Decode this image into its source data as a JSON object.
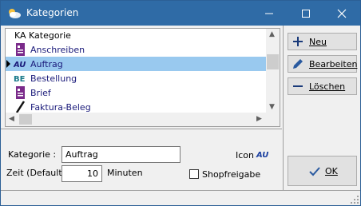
{
  "window": {
    "title": "Kategorien"
  },
  "list": {
    "headers": {
      "ka": "KA",
      "kategorie": "Kategorie"
    },
    "rows": [
      {
        "label": "Anschreiben",
        "icon": "purple-document-icon",
        "selected": false
      },
      {
        "label": "Auftrag",
        "icon": "au-text-icon",
        "selected": true
      },
      {
        "label": "Bestellung",
        "icon": "be-text-icon",
        "selected": false
      },
      {
        "label": "Brief",
        "icon": "purple-document-icon",
        "selected": false
      },
      {
        "label": "Faktura-Beleg",
        "icon": "pen-icon",
        "selected": false
      }
    ]
  },
  "form": {
    "kategorie_label": "Kategorie :",
    "kategorie_value": "Auftrag",
    "zeit_label": "Zeit (Default):",
    "zeit_value": "10",
    "minuten_label": "Minuten",
    "icon_label": "Icon",
    "icon_preview": "AU",
    "shop_label": "Shopfreigabe",
    "shop_checked": false
  },
  "buttons": {
    "neu": "Neu",
    "bearbeiten": "Bearbeiten",
    "loeschen": "Löschen",
    "ok": "OK"
  },
  "colors": {
    "titlebar": "#2f6ba6",
    "selection": "#99c9ef",
    "accent_purple": "#7a2a8a",
    "accent_blue": "#1a3fa0"
  }
}
